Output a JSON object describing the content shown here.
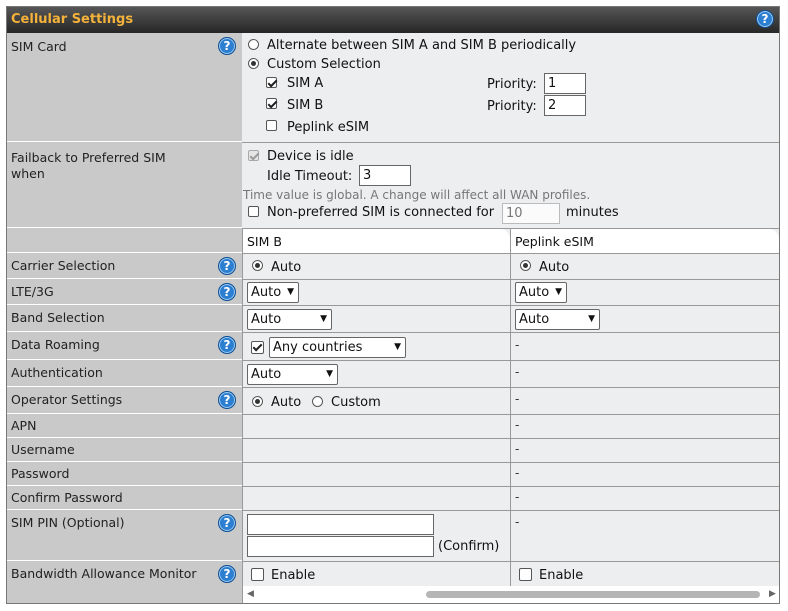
{
  "title": "Cellular Settings",
  "labels": {
    "sim_card": "SIM Card",
    "failback": "Failback to Preferred SIM when",
    "carrier": "Carrier Selection",
    "lte": "LTE/3G",
    "band": "Band Selection",
    "roaming": "Data Roaming",
    "auth": "Authentication",
    "operator": "Operator Settings",
    "apn": "APN",
    "username": "Username",
    "password": "Password",
    "confirm_password": "Confirm Password",
    "sim_pin": "SIM PIN (Optional)",
    "bandwidth": "Bandwidth Allowance Monitor"
  },
  "sim_card": {
    "alternate": "Alternate between SIM A and SIM B periodically",
    "custom": "Custom Selection",
    "sim_a": "SIM A",
    "sim_b": "SIM B",
    "esim": "Peplink eSIM",
    "priority_label": "Priority:",
    "priority_a": "1",
    "priority_b": "2"
  },
  "failback": {
    "device_idle": "Device is idle",
    "idle_timeout_label": "Idle Timeout:",
    "idle_timeout": "3",
    "note": "Time value is global. A change will affect all WAN profiles.",
    "non_preferred": "Non-preferred SIM is connected for",
    "minutes_value": "10",
    "minutes": "minutes"
  },
  "columns": [
    "SIM B",
    "Peplink eSIM"
  ],
  "col1": {
    "carrier": "Auto",
    "lte": "Auto",
    "band": "Auto",
    "roaming": "Any countries",
    "auth": "Auto",
    "op_auto": "Auto",
    "op_custom": "Custom",
    "confirm": "(Confirm)",
    "enable": "Enable"
  },
  "col2": {
    "carrier": "Auto",
    "lte": "Auto",
    "band": "Auto",
    "dash": "-",
    "enable": "Enable"
  },
  "help_icon": "?"
}
